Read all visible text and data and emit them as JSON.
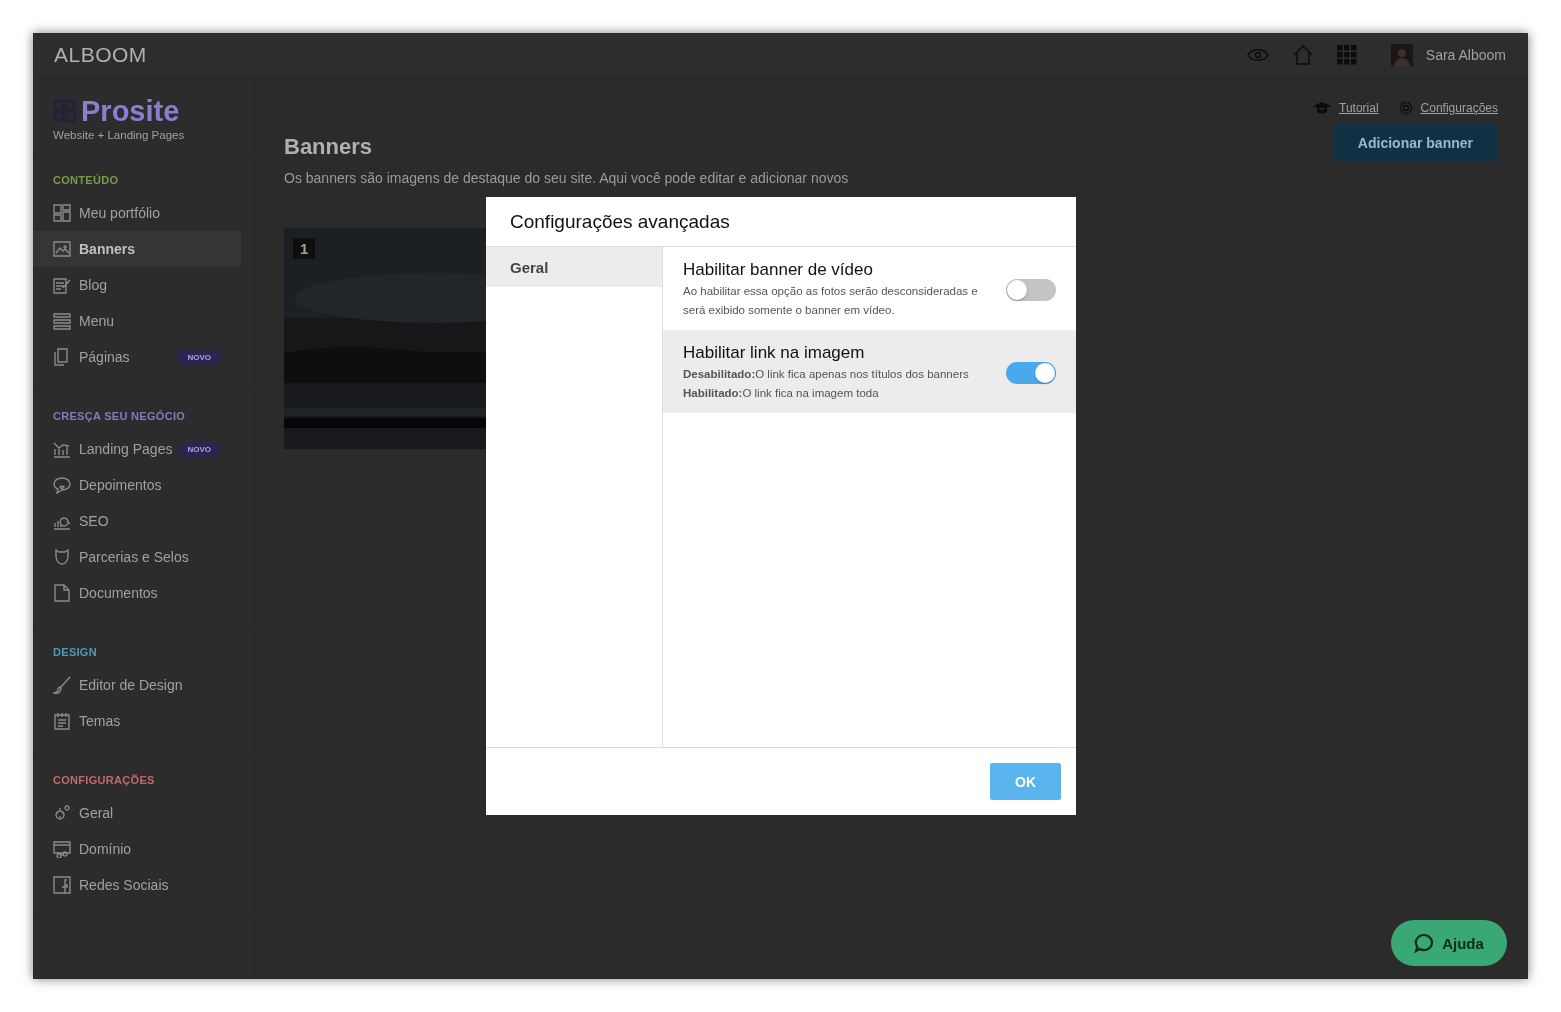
{
  "topbar": {
    "logo": "ALBOOM",
    "user_name": "Sara Alboom"
  },
  "sidebar": {
    "brand": "Prosite",
    "tagline": "Website + Landing Pages",
    "sections": [
      {
        "title": "CONTEÚDO",
        "color": "#7a9a4a",
        "items": [
          {
            "label": "Meu portfólio",
            "selected": false
          },
          {
            "label": "Banners",
            "selected": true
          },
          {
            "label": "Blog",
            "selected": false
          },
          {
            "label": "Menu",
            "selected": false
          },
          {
            "label": "Páginas",
            "badge": "NOVO",
            "selected": false
          }
        ]
      },
      {
        "title": "CRESÇA SEU NEGÓCIO",
        "color": "#7a7fb8",
        "items": [
          {
            "label": "Landing Pages",
            "badge": "NOVO",
            "selected": false
          },
          {
            "label": "Depoimentos",
            "selected": false
          },
          {
            "label": "SEO",
            "selected": false
          },
          {
            "label": "Parcerias e Selos",
            "selected": false
          },
          {
            "label": "Documentos",
            "selected": false
          }
        ]
      },
      {
        "title": "DESIGN",
        "color": "#4f9ab5",
        "items": [
          {
            "label": "Editor de Design",
            "selected": false
          },
          {
            "label": "Temas",
            "selected": false
          }
        ]
      },
      {
        "title": "CONFIGURAÇÕES",
        "color": "#c06a6a",
        "items": [
          {
            "label": "Geral",
            "selected": false
          },
          {
            "label": "Domínio",
            "selected": false
          },
          {
            "label": "Redes Sociais",
            "selected": false
          }
        ]
      }
    ]
  },
  "header_links": [
    {
      "label": "Tutorial"
    },
    {
      "label": "Configurações"
    }
  ],
  "page": {
    "title": "Banners",
    "subtitle": "Os banners são imagens de destaque do seu site. Aqui você pode editar e adicionar novos",
    "add_button": "Adicionar banner",
    "banners": [
      {
        "number": "1",
        "kind": "picture"
      }
    ]
  },
  "modal": {
    "title": "Configurações avançadas",
    "tabs": [
      {
        "label": "Geral",
        "selected": true
      }
    ],
    "settings": [
      {
        "title": "Habilitar banner de vídeo",
        "lines": [
          "Ao habilitar essa opção as fotos serão desconsideradas e será exibido somente o banner em vídeo."
        ],
        "on": false,
        "highlighted": false
      },
      {
        "title": "Habilitar link na imagem",
        "lines": [
          "**Desabilitado:**O link fica apenas nos títulos dos banners",
          "**Habilitado:**O link fica na imagem toda"
        ],
        "on": true,
        "highlighted": true
      }
    ],
    "ok_button": "OK"
  },
  "help_button": "Ajuda"
}
